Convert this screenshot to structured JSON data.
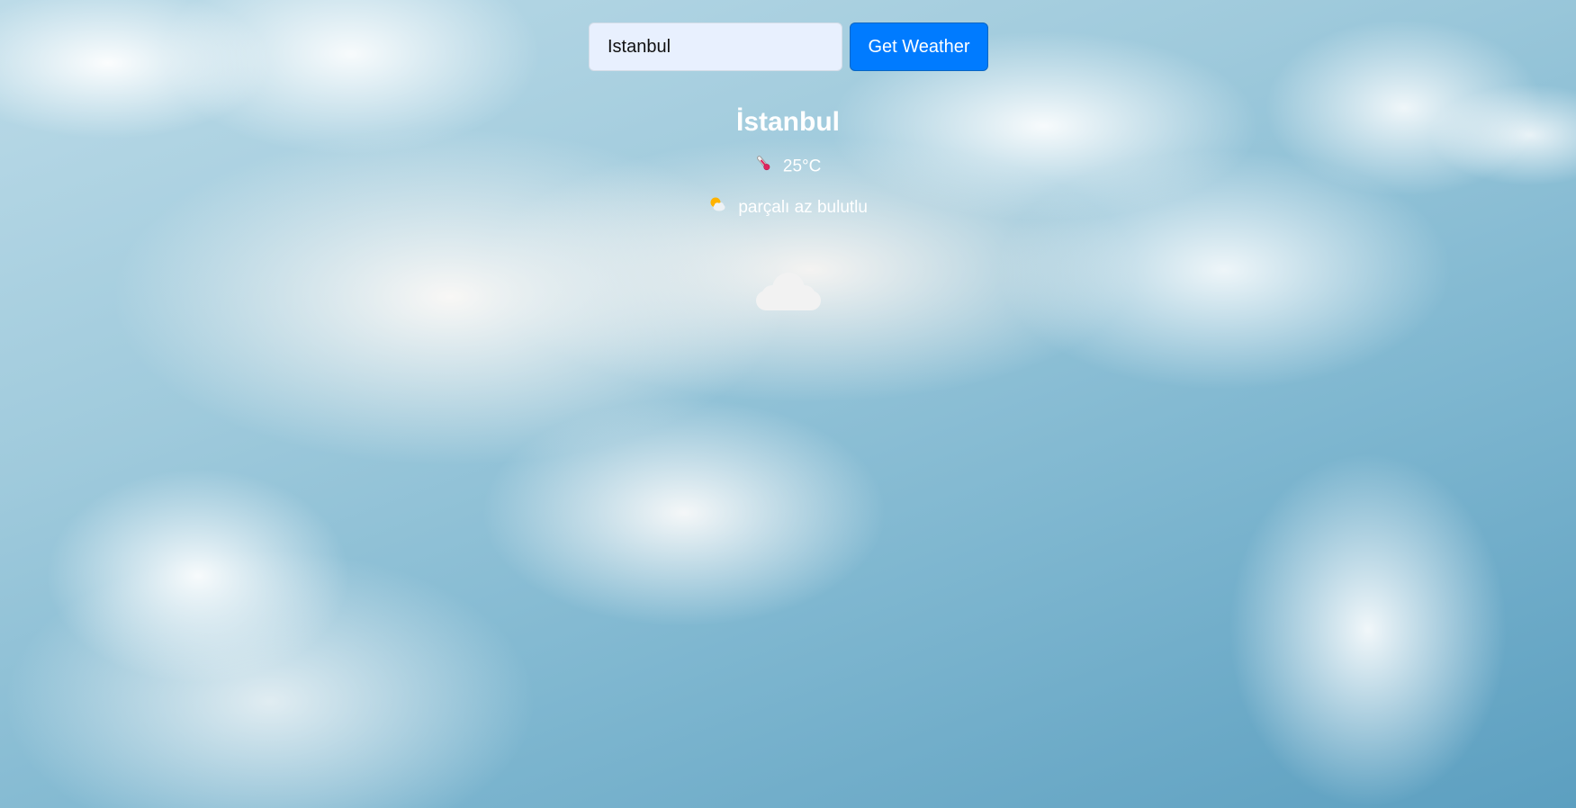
{
  "search": {
    "value": "Istanbul",
    "placeholder": "",
    "button_label": "Get Weather"
  },
  "weather": {
    "city": "İstanbul",
    "temperature": "25°C",
    "description": "parçalı az bulutlu",
    "icons": {
      "temperature": "thermometer-icon",
      "description": "sun-behind-cloud-icon",
      "condition": "cloud-icon"
    }
  },
  "colors": {
    "button_bg": "#007bff",
    "input_bg": "#e8f0fe",
    "text": "#ffffff"
  }
}
